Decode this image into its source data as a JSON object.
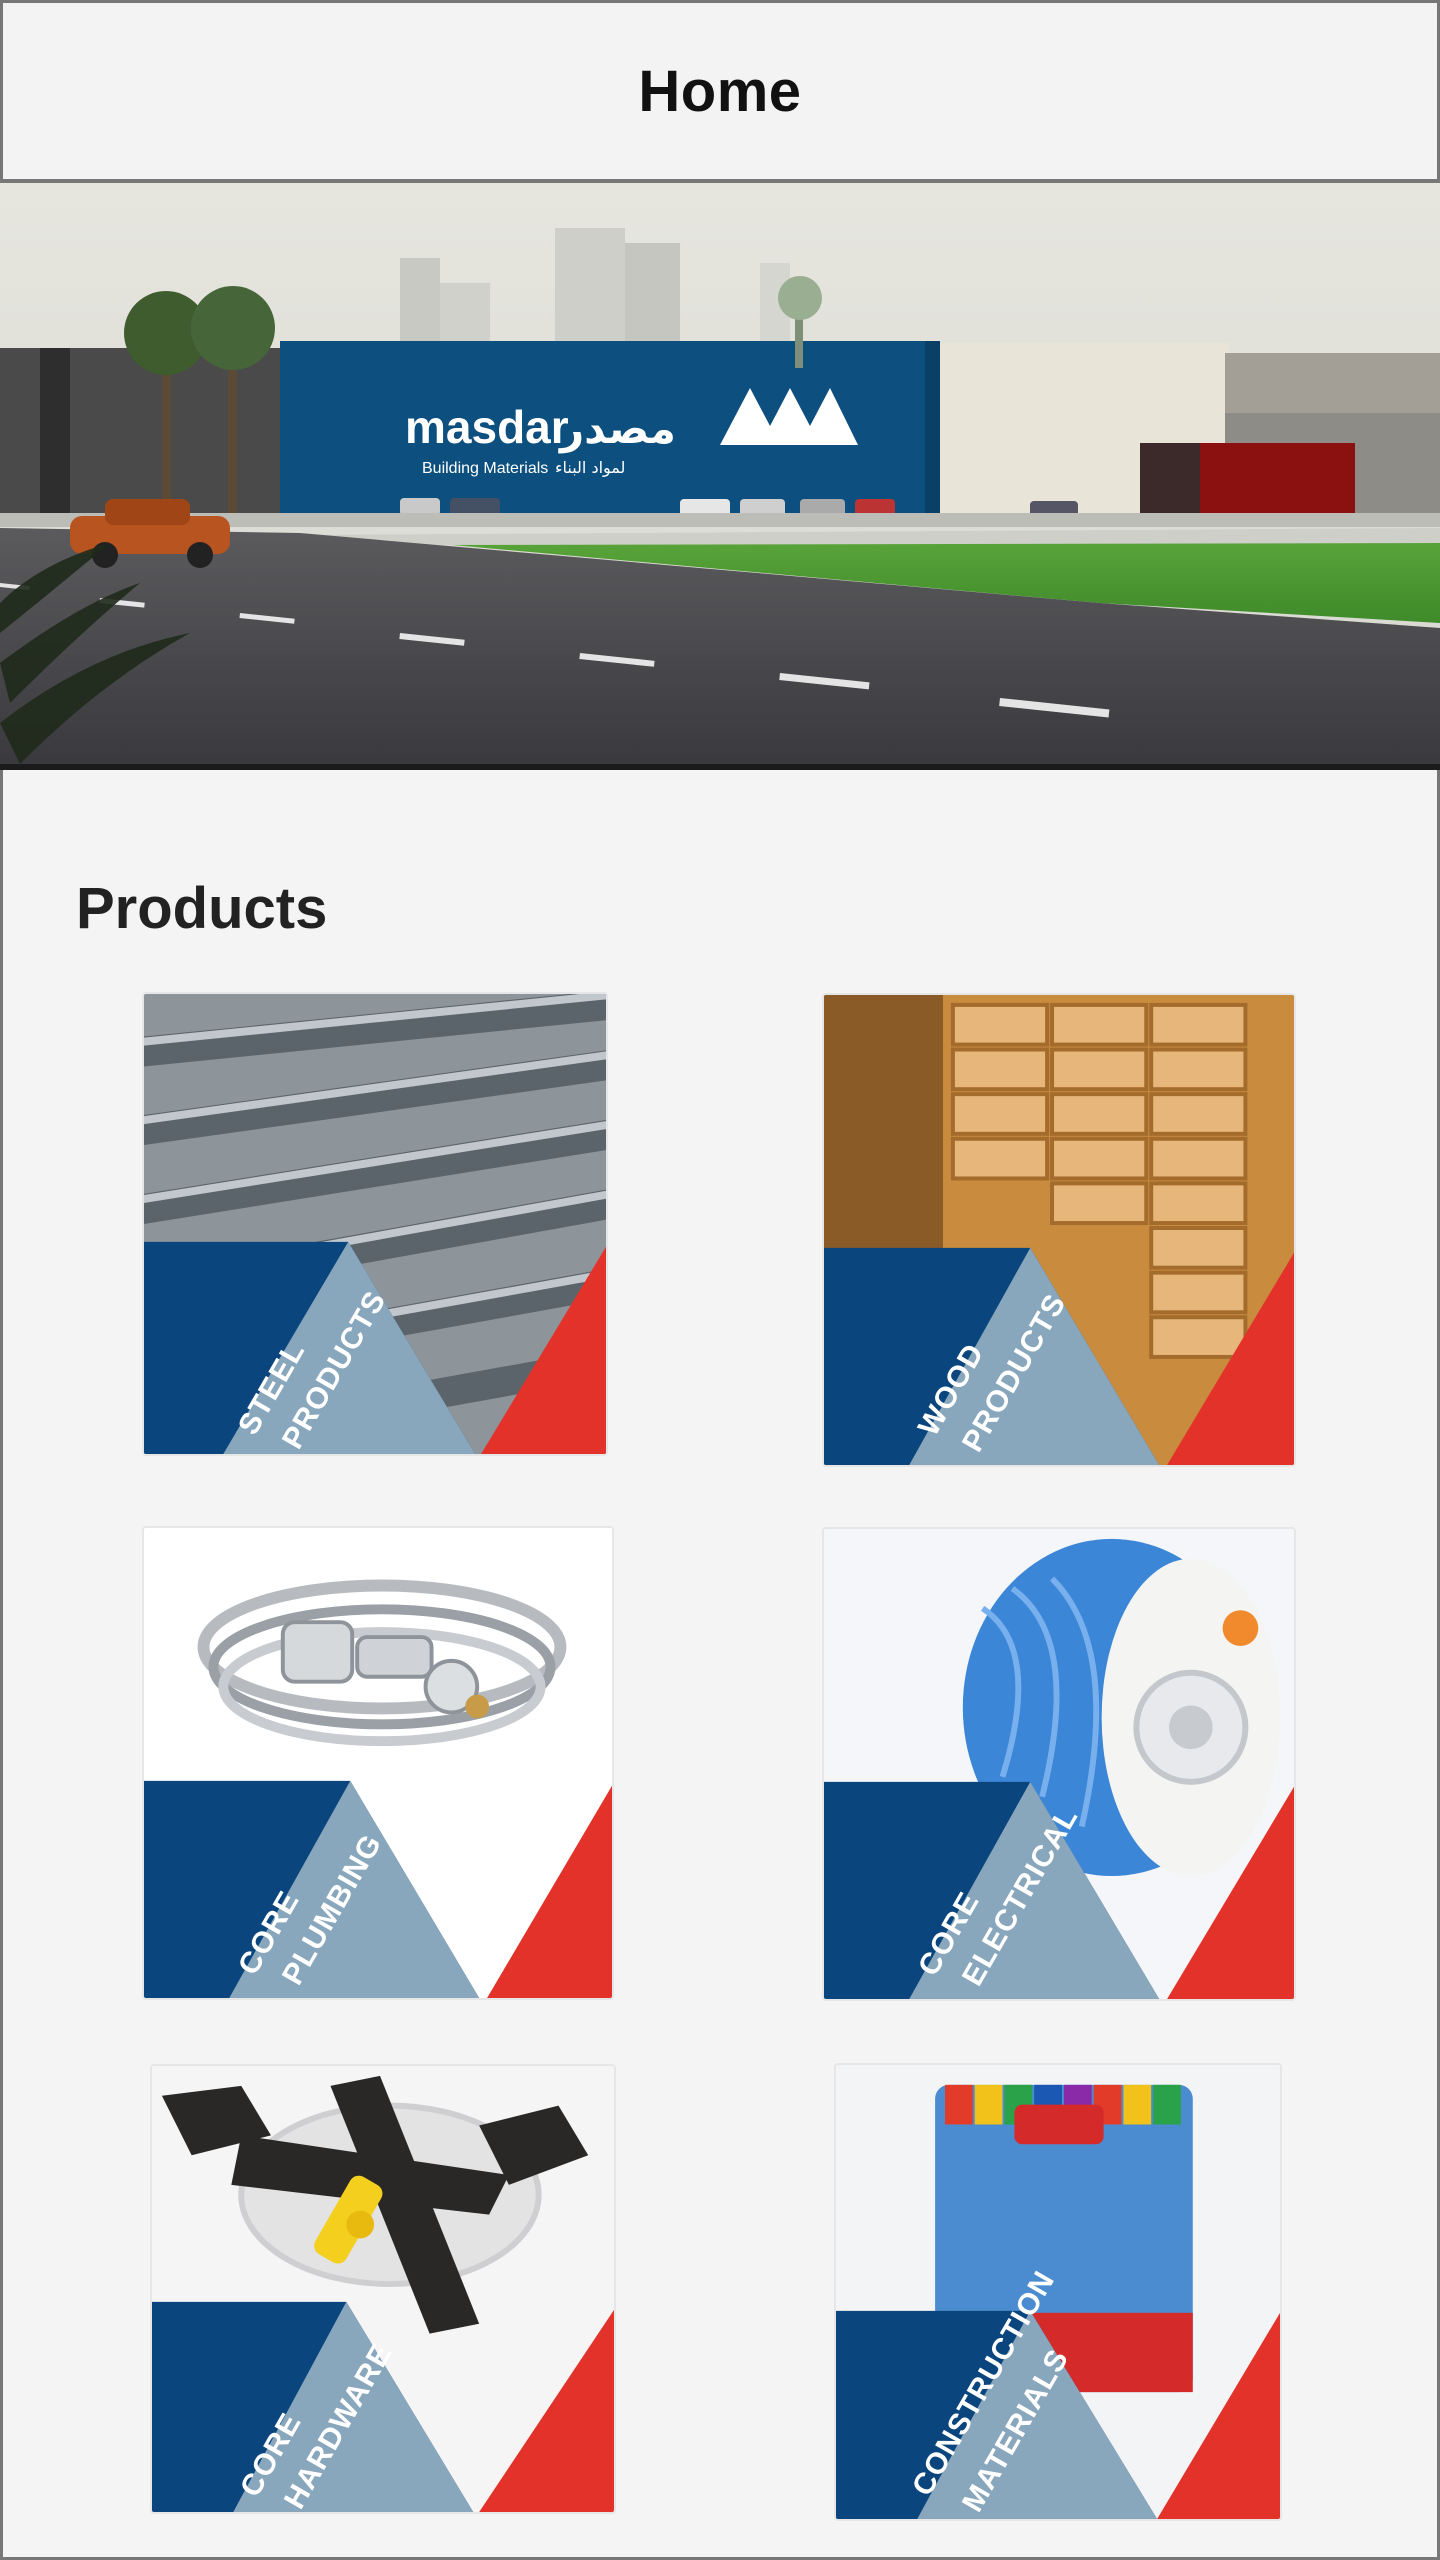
{
  "header": {
    "title": "Home"
  },
  "hero": {
    "brand_latin": "masdar",
    "brand_arabic": "مصدر",
    "brand_tagline_latin": "Building Materials",
    "brand_tagline_arabic": "لمواد البناء"
  },
  "products": {
    "title": "Products",
    "items": [
      {
        "line1": "STEEL",
        "line2": "PRODUCTS"
      },
      {
        "line1": "WOOD",
        "line2": "PRODUCTS"
      },
      {
        "line1": "CORE",
        "line2": "PLUMBING"
      },
      {
        "line1": "CORE",
        "line2": "ELECTRICAL"
      },
      {
        "line1": "CORE",
        "line2": "HARDWARE"
      },
      {
        "line1": "CONSTRUCTION",
        "line2": "MATERIALS"
      }
    ]
  },
  "colors": {
    "brand_blue": "#08467c",
    "brand_light_blue": "#86a6ba",
    "brand_red": "#e2322a"
  }
}
